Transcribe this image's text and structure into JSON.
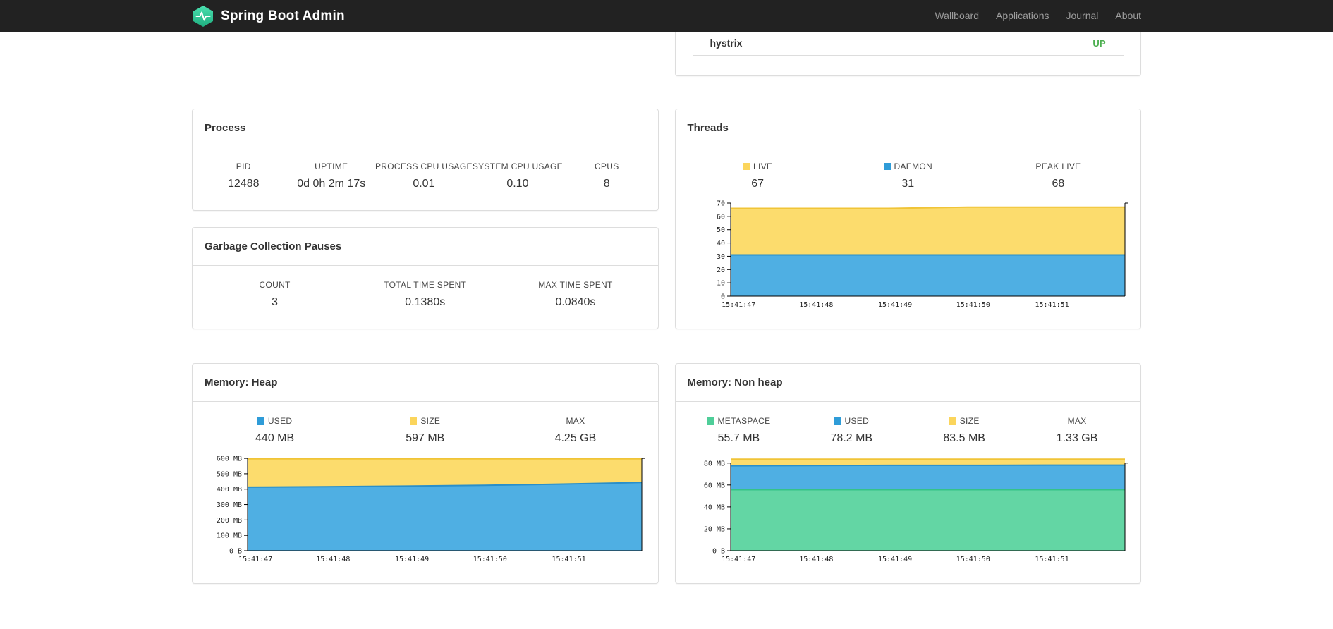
{
  "navbar": {
    "brand": "Spring Boot Admin",
    "links": [
      "Wallboard",
      "Applications",
      "Journal",
      "About"
    ]
  },
  "application": {
    "name": "hystrix",
    "status": "UP"
  },
  "panels": {
    "process": {
      "title": "Process",
      "stats": [
        {
          "label": "PID",
          "value": "12488"
        },
        {
          "label": "UPTIME",
          "value": "0d 0h 2m 17s"
        },
        {
          "label": "PROCESS CPU USAGE",
          "value": "0.01"
        },
        {
          "label": "SYSTEM CPU USAGE",
          "value": "0.10"
        },
        {
          "label": "CPUS",
          "value": "8"
        }
      ]
    },
    "gc": {
      "title": "Garbage Collection Pauses",
      "stats": [
        {
          "label": "COUNT",
          "value": "3"
        },
        {
          "label": "TOTAL TIME SPENT",
          "value": "0.1380s"
        },
        {
          "label": "MAX TIME SPENT",
          "value": "0.0840s"
        }
      ]
    },
    "threads": {
      "title": "Threads",
      "stats": [
        {
          "label": "LIVE",
          "value": "67",
          "swatch": "#FBD55C"
        },
        {
          "label": "DAEMON",
          "value": "31",
          "swatch": "#2F9CD8"
        },
        {
          "label": "PEAK LIVE",
          "value": "68"
        }
      ]
    },
    "heap": {
      "title": "Memory: Heap",
      "stats": [
        {
          "label": "USED",
          "value": "440 MB",
          "swatch": "#2F9CD8"
        },
        {
          "label": "SIZE",
          "value": "597 MB",
          "swatch": "#FBD55C"
        },
        {
          "label": "MAX",
          "value": "4.25 GB"
        }
      ]
    },
    "nonheap": {
      "title": "Memory: Non heap",
      "stats": [
        {
          "label": "METASPACE",
          "value": "55.7 MB",
          "swatch": "#4FCE99"
        },
        {
          "label": "USED",
          "value": "78.2 MB",
          "swatch": "#2F9CD8"
        },
        {
          "label": "SIZE",
          "value": "83.5 MB",
          "swatch": "#FBD55C"
        },
        {
          "label": "MAX",
          "value": "1.33 GB"
        }
      ]
    }
  },
  "chart_data": [
    {
      "id": "threads",
      "type": "area",
      "title": "Threads",
      "x_tick_labels": [
        "15:41:47",
        "15:41:48",
        "15:41:49",
        "15:41:50",
        "15:41:51"
      ],
      "x_tick_fractions": [
        0.02,
        0.217,
        0.417,
        0.615,
        0.815
      ],
      "ylim": [
        0,
        70
      ],
      "yticks": [
        0,
        10,
        20,
        30,
        40,
        50,
        60,
        70
      ],
      "ytick_labels": [
        "0",
        "10",
        "20",
        "30",
        "40",
        "50",
        "60",
        "70"
      ],
      "series": [
        {
          "name": "LIVE",
          "fill": "#FCDC6D",
          "stroke": "#F0C437",
          "values": [
            66,
            66,
            66,
            67,
            67,
            67
          ]
        },
        {
          "name": "DAEMON",
          "fill": "#4FAFE3",
          "stroke": "#2A8FC9",
          "values": [
            31,
            31,
            31,
            31,
            31,
            31
          ]
        }
      ]
    },
    {
      "id": "memory-heap",
      "type": "area",
      "title": "Memory: Heap",
      "x_tick_labels": [
        "15:41:47",
        "15:41:48",
        "15:41:49",
        "15:41:50",
        "15:41:51"
      ],
      "x_tick_fractions": [
        0.02,
        0.217,
        0.417,
        0.615,
        0.815
      ],
      "ylim": [
        0,
        605
      ],
      "yticks": [
        0,
        100,
        200,
        300,
        400,
        500,
        600
      ],
      "ytick_labels": [
        "0 B",
        "100 MB",
        "200 MB",
        "300 MB",
        "400 MB",
        "500 MB",
        "600 MB"
      ],
      "series": [
        {
          "name": "SIZE",
          "fill": "#FCDC6D",
          "stroke": "#F0C437",
          "values": [
            597,
            597,
            597,
            597,
            597,
            597
          ]
        },
        {
          "name": "USED",
          "fill": "#4FAFE3",
          "stroke": "#2A8FC9",
          "values": [
            413,
            416,
            420,
            425,
            433,
            443
          ]
        }
      ]
    },
    {
      "id": "memory-nonheap",
      "type": "area",
      "title": "Memory: Non heap",
      "x_tick_labels": [
        "15:41:47",
        "15:41:48",
        "15:41:49",
        "15:41:50",
        "15:41:51"
      ],
      "x_tick_fractions": [
        0.02,
        0.217,
        0.417,
        0.615,
        0.815
      ],
      "ylim": [
        0,
        85
      ],
      "yticks": [
        0,
        20,
        40,
        60,
        80
      ],
      "ytick_labels": [
        "0 B",
        "20 MB",
        "40 MB",
        "60 MB",
        "80 MB"
      ],
      "series": [
        {
          "name": "SIZE",
          "fill": "#FCDC6D",
          "stroke": "#F0C437",
          "values": [
            83.5,
            83.5,
            83.5,
            83.5,
            83.5,
            83.5
          ]
        },
        {
          "name": "USED",
          "fill": "#4FAFE3",
          "stroke": "#2A8FC9",
          "values": [
            77.5,
            77.8,
            78,
            78,
            78.2,
            78.2
          ]
        },
        {
          "name": "METASPACE",
          "fill": "#63D6A4",
          "stroke": "#35C287",
          "values": [
            55.7,
            55.7,
            55.7,
            55.7,
            55.7,
            55.7
          ]
        }
      ]
    }
  ],
  "colors": {
    "navbar_bg": "#222222",
    "nav_link": "#9d9d9d",
    "brand_green_light": "#4BE0B0",
    "brand_green_dark": "#1FAE7F",
    "status_up": "#4CAF50",
    "yellow_fill": "#FCDC6D",
    "yellow_stroke": "#F0C437",
    "blue_fill": "#4FAFE3",
    "blue_stroke": "#2A8FC9",
    "green_fill": "#63D6A4",
    "green_stroke": "#35C287",
    "panel_border": "#dddddd"
  }
}
